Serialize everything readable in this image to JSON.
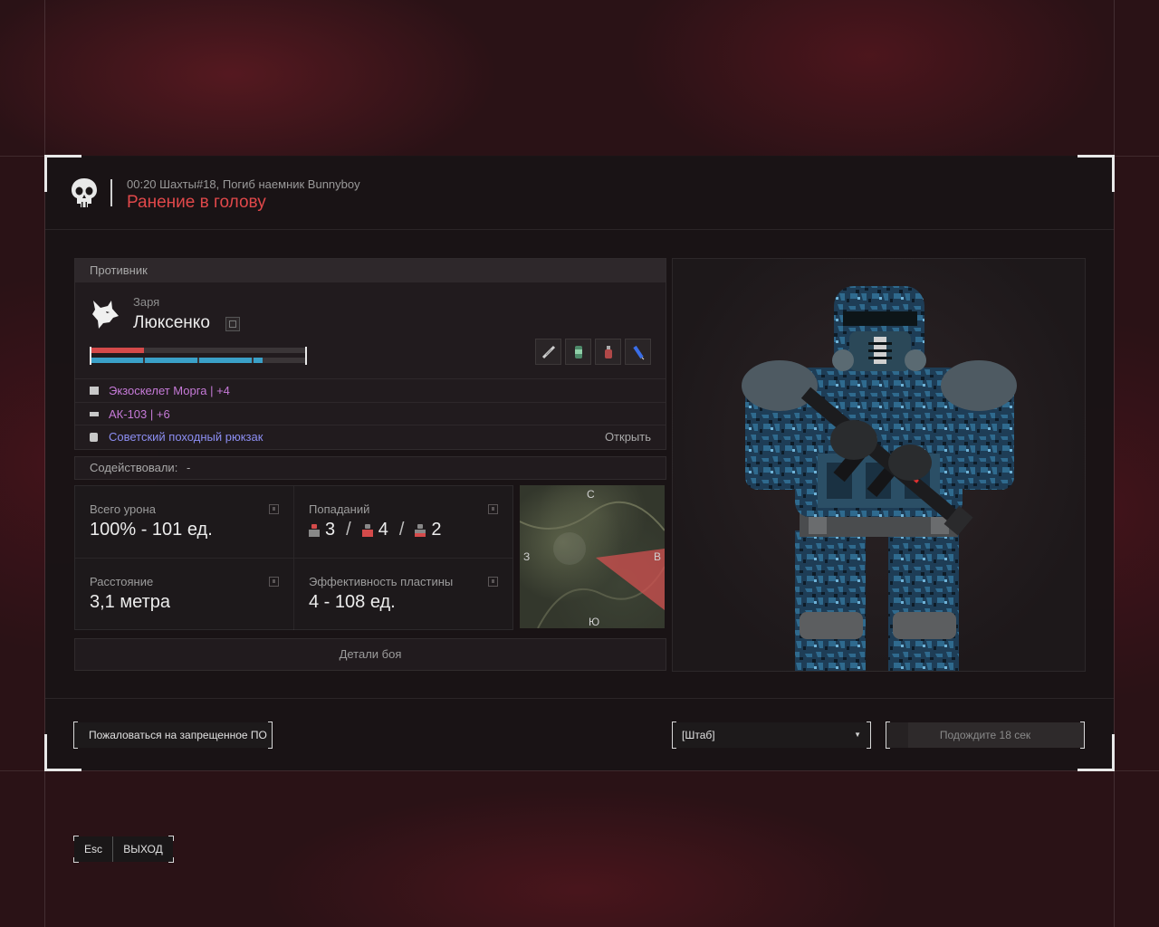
{
  "header": {
    "event_line": "00:20 Шахты#18, Погиб наемник Bunnyboy",
    "death_cause": "Ранение в голову"
  },
  "enemy": {
    "section_title": "Противник",
    "clan": "Заря",
    "nickname": "Люксенко",
    "health_fraction": 0.25,
    "armor_fraction": 0.8,
    "quick_slots": [
      "bandage-icon",
      "can-icon",
      "bottle-icon",
      "syringe-icon"
    ],
    "equipment": [
      {
        "icon": "armor-icon",
        "name": "Экзоскелет Морга",
        "sep": "|",
        "upgrade": "+4",
        "color": "#c67ad8"
      },
      {
        "icon": "rifle-icon",
        "name": "АК-103",
        "sep": "|",
        "upgrade": "+6",
        "color": "#c67ad8"
      },
      {
        "icon": "backpack-icon",
        "name": "Советский походный рюкзак",
        "color": "#8c8ef2",
        "action": "Открыть"
      }
    ]
  },
  "assist": {
    "label": "Содействовали:",
    "value": "-"
  },
  "stats": {
    "damage_label": "Всего урона",
    "damage_value": "100% - 101 ед.",
    "hits_label": "Попаданий",
    "hits": {
      "head": "3",
      "body": "4",
      "legs": "2",
      "sep": "/"
    },
    "distance_label": "Расстояние",
    "distance_value": "3,1 метра",
    "plate_label": "Эффективность пластины",
    "plate_value": "4 - 108 ед."
  },
  "minimap": {
    "north": "С",
    "south": "Ю",
    "west": "З",
    "east": "В"
  },
  "details_button": "Детали боя",
  "footer": {
    "report_button": "Пожаловаться на запрещенное ПО",
    "location_select": "[Штаб]",
    "wait_button": "Подождите 18 сек"
  },
  "exit": {
    "key": "Esc",
    "label": "ВЫХОД"
  }
}
